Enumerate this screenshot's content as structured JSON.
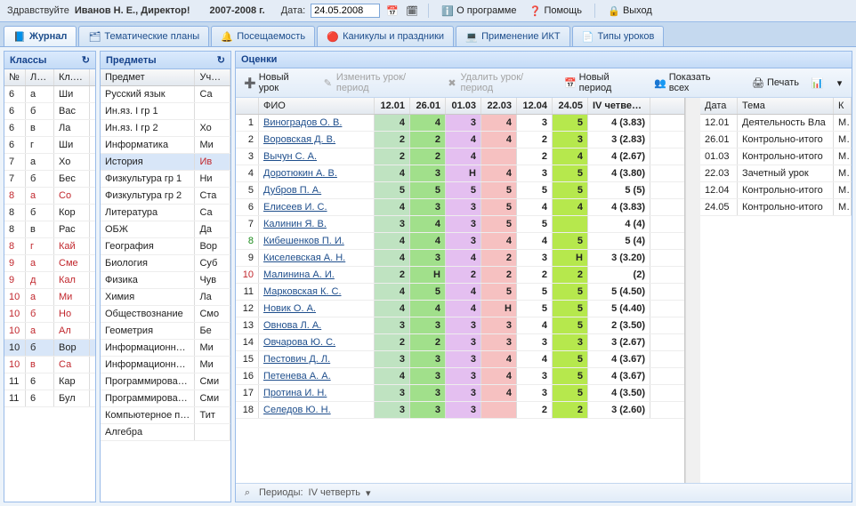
{
  "topbar": {
    "greeting": "Здравствуйте",
    "user": "Иванов Н. Е., Директор!",
    "year": "2007-2008 г.",
    "date_label": "Дата:",
    "date_value": "24.05.2008",
    "about": "О программе",
    "help": "Помощь",
    "exit": "Выход"
  },
  "tabs": [
    {
      "label": "Журнал",
      "icon": "📘",
      "active": true
    },
    {
      "label": "Тематические планы",
      "icon": "🗂",
      "active": false
    },
    {
      "label": "Посещаемость",
      "icon": "🔔",
      "active": false
    },
    {
      "label": "Каникулы и праздники",
      "icon": "🔴",
      "active": false
    },
    {
      "label": "Применение ИКТ",
      "icon": "💻",
      "active": false
    },
    {
      "label": "Типы уроков",
      "icon": "📄",
      "active": false
    }
  ],
  "classes": {
    "title": "Классы",
    "cols": [
      "№",
      "Лите",
      "Кл. Ру"
    ],
    "rows": [
      [
        "6",
        "а",
        "Ши"
      ],
      [
        "6",
        "б",
        "Вас"
      ],
      [
        "6",
        "в",
        "Ла"
      ],
      [
        "6",
        "г",
        "Ши"
      ],
      [
        "7",
        "а",
        "Хо"
      ],
      [
        "7",
        "б",
        "Бес"
      ],
      [
        "8",
        "а",
        "Со",
        true
      ],
      [
        "8",
        "б",
        "Кор"
      ],
      [
        "8",
        "в",
        "Рас"
      ],
      [
        "8",
        "г",
        "Кай",
        true
      ],
      [
        "9",
        "а",
        "Сме",
        true
      ],
      [
        "9",
        "д",
        "Кал",
        true
      ],
      [
        "10",
        "а",
        "Ми",
        true
      ],
      [
        "10",
        "б",
        "Но",
        true
      ],
      [
        "10",
        "а",
        "Ал",
        true
      ],
      [
        "10",
        "б",
        "Вор",
        "sel"
      ],
      [
        "10",
        "в",
        "Са",
        true
      ],
      [
        "11",
        "6",
        "Кар"
      ],
      [
        "11",
        "6",
        "Бул"
      ]
    ]
  },
  "subjects": {
    "title": "Предметы",
    "cols": [
      "Предмет",
      "Учите."
    ],
    "rows": [
      [
        "Русский язык",
        "Са"
      ],
      [
        "Ин.яз. I гр 1",
        ""
      ],
      [
        "Ин.яз. I гр 2",
        "Хо"
      ],
      [
        "Информатика",
        "Ми"
      ],
      [
        "История",
        "Ив",
        "sel"
      ],
      [
        "Физкультура гр 1",
        "Ни"
      ],
      [
        "Физкультура гр 2",
        "Ста"
      ],
      [
        "Литература",
        "Са"
      ],
      [
        "ОБЖ",
        "Да"
      ],
      [
        "География",
        "Вор"
      ],
      [
        "Биология",
        "Суб"
      ],
      [
        "Физика",
        "Чув"
      ],
      [
        "Химия",
        "Ла"
      ],
      [
        "Обществознание",
        "Смо"
      ],
      [
        "Геометрия",
        "Бе"
      ],
      [
        "Информационные т",
        "Ми"
      ],
      [
        "Информационные т",
        "Ми"
      ],
      [
        "Программирование",
        "Сми"
      ],
      [
        "Программирование",
        "Сми"
      ],
      [
        "Компьютерное про",
        "Тит"
      ],
      [
        "Алгебра",
        ""
      ]
    ]
  },
  "grades": {
    "title": "Оценки",
    "toolbar": {
      "new_lesson": "Новый урок",
      "edit": "Изменить урок/период",
      "delete": "Удалить урок/период",
      "new_period": "Новый период",
      "show_all": "Показать всех",
      "print": "Печать"
    },
    "date_cols": [
      "12.01",
      "26.01",
      "01.03",
      "22.03",
      "12.04",
      "24.05"
    ],
    "quarter_col": "IV четверть",
    "name_col": "ФИО",
    "students": [
      {
        "n": 1,
        "name": "Виноградов О. В.",
        "g": [
          "4",
          "4",
          "3",
          "4",
          "3",
          "5"
        ],
        "avg": "4 (3.83)"
      },
      {
        "n": 2,
        "name": "Воровская Д. В.",
        "g": [
          "2",
          "2",
          "4",
          "4",
          "2",
          "3"
        ],
        "avg": "3 (2.83)"
      },
      {
        "n": 3,
        "name": "Вычун С. А.",
        "g": [
          "2",
          "2",
          "4",
          "",
          "2",
          "4"
        ],
        "avg": "4 (2.67)"
      },
      {
        "n": 4,
        "name": "Доротюкин А. В.",
        "g": [
          "4",
          "3",
          "Н",
          "4",
          "3",
          "5"
        ],
        "avg": "4 (3.80)"
      },
      {
        "n": 5,
        "name": "Дубров П. А.",
        "g": [
          "5",
          "5",
          "5",
          "5",
          "5",
          "5"
        ],
        "avg": "5 (5)"
      },
      {
        "n": 6,
        "name": "Елисеев И. С.",
        "g": [
          "4",
          "3",
          "3",
          "5",
          "4",
          "4"
        ],
        "avg": "4 (3.83)"
      },
      {
        "n": 7,
        "name": "Калинин Я. В.",
        "g": [
          "3",
          "4",
          "3",
          "5",
          "5",
          ""
        ],
        "avg": "4 (4)"
      },
      {
        "n": 8,
        "name": "Кибешенков П. И.",
        "g": [
          "4",
          "4",
          "3",
          "4",
          "4",
          "5"
        ],
        "avg": "5 (4)",
        "green": true
      },
      {
        "n": 9,
        "name": "Киселевская А. Н.",
        "g": [
          "4",
          "3",
          "4",
          "2",
          "3",
          "Н"
        ],
        "avg": "3 (3.20)"
      },
      {
        "n": 10,
        "name": "Малинина А. И.",
        "g": [
          "2",
          "Н",
          "2",
          "2",
          "2",
          "2"
        ],
        "avg": "(2)",
        "red": true
      },
      {
        "n": 11,
        "name": "Марковская К. С.",
        "g": [
          "4",
          "5",
          "4",
          "5",
          "5",
          "5"
        ],
        "avg": "5 (4.50)"
      },
      {
        "n": 12,
        "name": "Новик О. А.",
        "g": [
          "4",
          "4",
          "4",
          "Н",
          "5",
          "5"
        ],
        "avg": "5 (4.40)"
      },
      {
        "n": 13,
        "name": "Овнова Л. А.",
        "g": [
          "3",
          "3",
          "3",
          "3",
          "4",
          "5"
        ],
        "avg": "2 (3.50)"
      },
      {
        "n": 14,
        "name": "Овчарова Ю. С.",
        "g": [
          "2",
          "2",
          "3",
          "3",
          "3",
          "3"
        ],
        "avg": "3 (2.67)"
      },
      {
        "n": 15,
        "name": "Пестович Д. Л.",
        "g": [
          "3",
          "3",
          "3",
          "4",
          "4",
          "5"
        ],
        "avg": "4 (3.67)"
      },
      {
        "n": 16,
        "name": "Петенева А. А.",
        "g": [
          "4",
          "3",
          "3",
          "4",
          "3",
          "5"
        ],
        "avg": "4 (3.67)"
      },
      {
        "n": 17,
        "name": "Протина И. Н.",
        "g": [
          "3",
          "3",
          "3",
          "4",
          "3",
          "5"
        ],
        "avg": "4 (3.50)"
      },
      {
        "n": 18,
        "name": "Селедов Ю. Н.",
        "g": [
          "3",
          "3",
          "3",
          "",
          "2",
          "2"
        ],
        "avg": "3 (2.60)"
      }
    ],
    "footer_label": "Периоды:",
    "footer_value": "IV четверть",
    "side_cols": [
      "Дата",
      "Тема",
      "К"
    ],
    "side_rows": [
      [
        "12.01",
        "Деятельность Вла",
        "М"
      ],
      [
        "26.01",
        "Контрольно-итого",
        "М"
      ],
      [
        "01.03",
        "Контрольно-итого",
        "М"
      ],
      [
        "22.03",
        "Зачетный урок",
        "М"
      ],
      [
        "12.04",
        "Контрольно-итого",
        "М"
      ],
      [
        "24.05",
        "Контрольно-итого",
        "М"
      ]
    ]
  }
}
